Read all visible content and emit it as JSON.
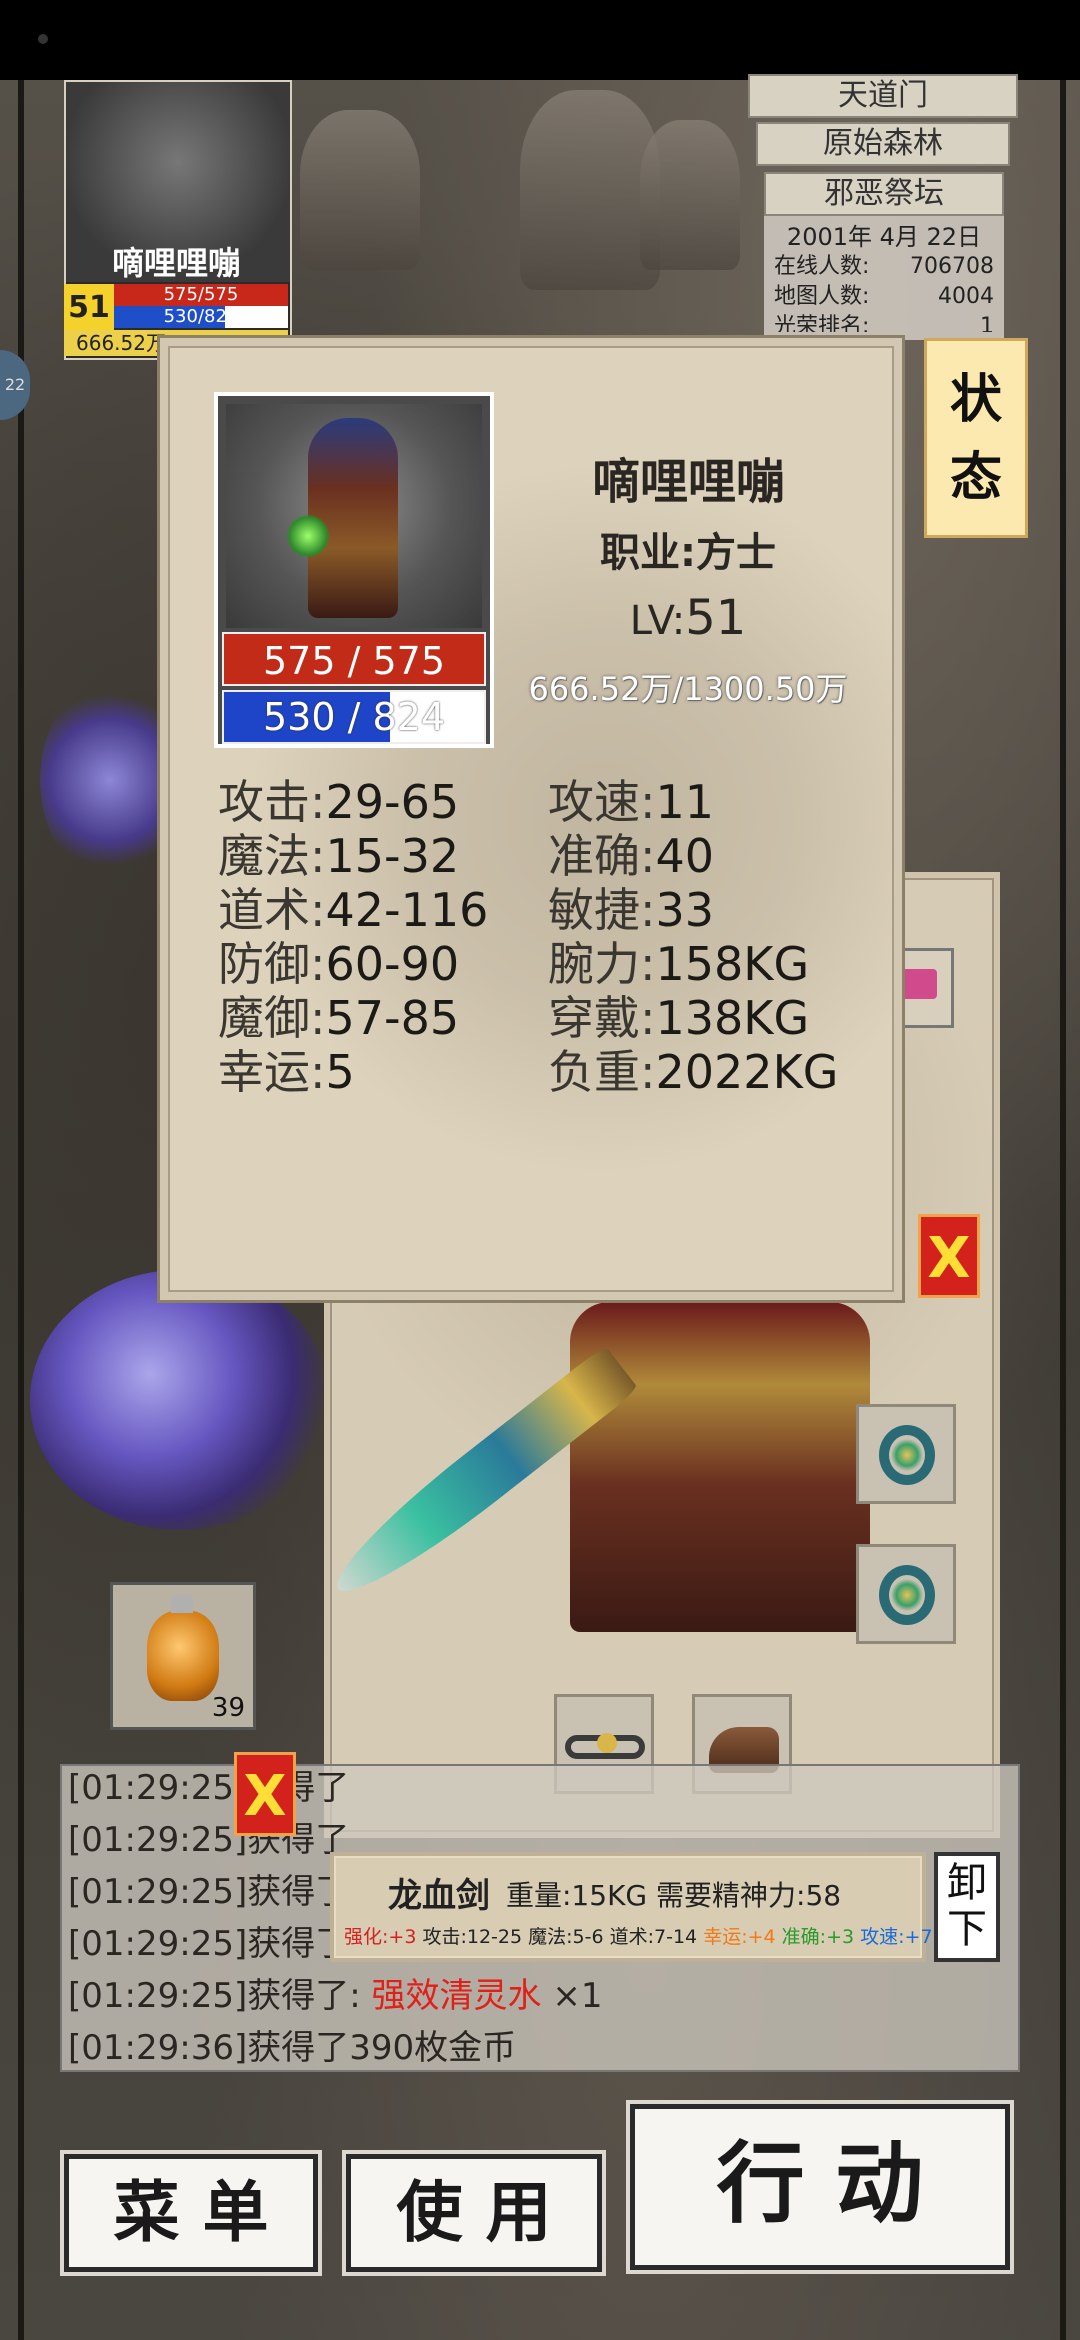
{
  "mini_player": {
    "name": "嘀哩哩嘣",
    "level": "51",
    "hp": "575/575",
    "mp": "530/824",
    "exp": "666.52万"
  },
  "map_list": {
    "item1": "天道门",
    "item2": "原始森林",
    "item3": "邪恶祭坛"
  },
  "info": {
    "date": "2001年 4月 22日",
    "online_label": "在线人数:",
    "online_value": "706708",
    "map_label": "地图人数:",
    "map_value": "4004",
    "rank_label": "光荣排名:",
    "rank_value": "1"
  },
  "side_number": "22",
  "status_tab": {
    "line1": "状",
    "line2": "态"
  },
  "stats_panel": {
    "name": "嘀哩哩嘣",
    "class": "职业:方士",
    "lv_label": "LV:",
    "lv_value": "51",
    "exp": "666.52万/1300.50万",
    "hp_text": "575 / 575",
    "mp_text": "530 / 824",
    "mp_fraction": 0.64,
    "left_stats": [
      {
        "key": "攻击:",
        "value": "29-65"
      },
      {
        "key": "魔法:",
        "value": "15-32"
      },
      {
        "key": "道术:",
        "value": "42-116"
      },
      {
        "key": "防御:",
        "value": "60-90"
      },
      {
        "key": "魔御:",
        "value": "57-85"
      },
      {
        "key": "幸运:",
        "value": "5"
      }
    ],
    "right_stats": [
      {
        "key": "攻速:",
        "value": "11"
      },
      {
        "key": "准确:",
        "value": "40"
      },
      {
        "key": "敏捷:",
        "value": "33"
      },
      {
        "key": "腕力:",
        "value": "158KG"
      },
      {
        "key": "穿戴:",
        "value": "138KG"
      },
      {
        "key": "负重:",
        "value": "2022KG"
      }
    ]
  },
  "close_label": "X",
  "potion": {
    "count": "39"
  },
  "chat": [
    {
      "time": "[01:29:25]",
      "text": "获得了"
    },
    {
      "time": "[01:29:25]",
      "text": "获得了"
    },
    {
      "time": "[01:29:25]",
      "text": "获得了"
    },
    {
      "time": "[01:29:25]",
      "text": "获得了"
    },
    {
      "time": "[01:29:25]",
      "text": "获得了:",
      "item": "强效清灵水",
      "qty": "×1"
    },
    {
      "time": "[01:29:36]",
      "text": "获得了390枚金币"
    }
  ],
  "item_tooltip": {
    "name": "龙血剑",
    "meta": "重量:15KG 需要精神力:58",
    "enhance": "强化:+3",
    "attack": "攻击:12-25",
    "magic": "魔法:5-6",
    "tao": "道术:7-14",
    "luck": "幸运:+4",
    "accuracy": "准确:+3",
    "speed": "攻速:+7"
  },
  "unequip": {
    "line1": "卸",
    "line2": "下"
  },
  "buttons": {
    "menu": "菜 单",
    "use": "使 用",
    "action": "行 动"
  },
  "colors": {
    "hp": "#c22b17",
    "mp": "#1e44c8",
    "level_bg": "#f5d12c",
    "status_tab_bg": "#fbe9b0",
    "close_bg": "#d3211b"
  }
}
